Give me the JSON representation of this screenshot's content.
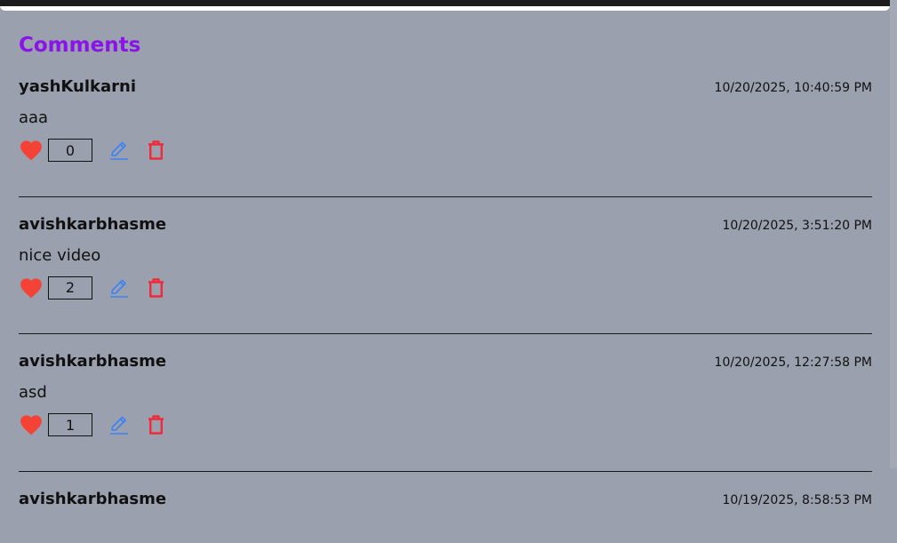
{
  "section": {
    "title": "Comments"
  },
  "colors": {
    "accent": "#8a14e8",
    "heart": "#f44336",
    "edit": "#3b82f6",
    "delete": "#ef2a3a"
  },
  "comments": [
    {
      "author": "yashKulkarni",
      "date": "10/20/2025, 10:40:59 PM",
      "text": "aaa",
      "likes": "0"
    },
    {
      "author": "avishkarbhasme",
      "date": "10/20/2025, 3:51:20 PM",
      "text": "nice video",
      "likes": "2"
    },
    {
      "author": "avishkarbhasme",
      "date": "10/20/2025, 12:27:58 PM",
      "text": "asd",
      "likes": "1"
    },
    {
      "author": "avishkarbhasme",
      "date": "10/19/2025, 8:58:53 PM"
    }
  ]
}
